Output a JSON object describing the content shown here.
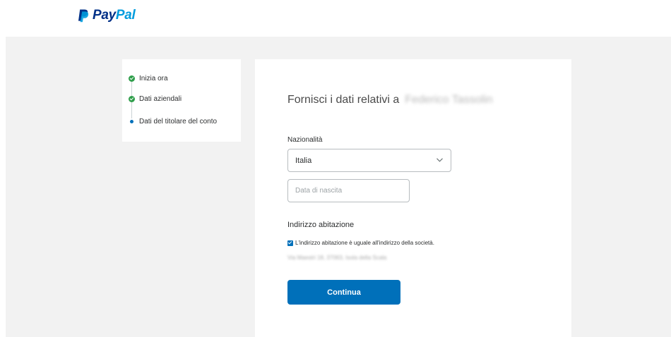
{
  "brand": {
    "logo_pay": "Pay",
    "logo_pal": "Pal"
  },
  "steps": [
    {
      "label": "Inizia ora",
      "status": "done"
    },
    {
      "label": "Dati aziendali",
      "status": "done"
    },
    {
      "label": "Dati del titolare del conto",
      "status": "current"
    }
  ],
  "form": {
    "title_prefix": "Fornisci i dati relativi a",
    "title_name": "Federico Tassolin",
    "nationality_label": "Nazionalità",
    "nationality_value": "Italia",
    "dob_placeholder": "Data di nascita",
    "home_address_label": "Indirizzo abitazione",
    "same_address_checkbox_label": "L'indirizzo abitazione è uguale all'indirizzo della società.",
    "same_address_checked": true,
    "address_text": "Via Maestri 18, 37063, Isola della Scala",
    "continue_label": "Continua"
  },
  "colors": {
    "accent": "#0070ba",
    "done": "#2e9e4a",
    "background_band": "#f2f2f2"
  }
}
